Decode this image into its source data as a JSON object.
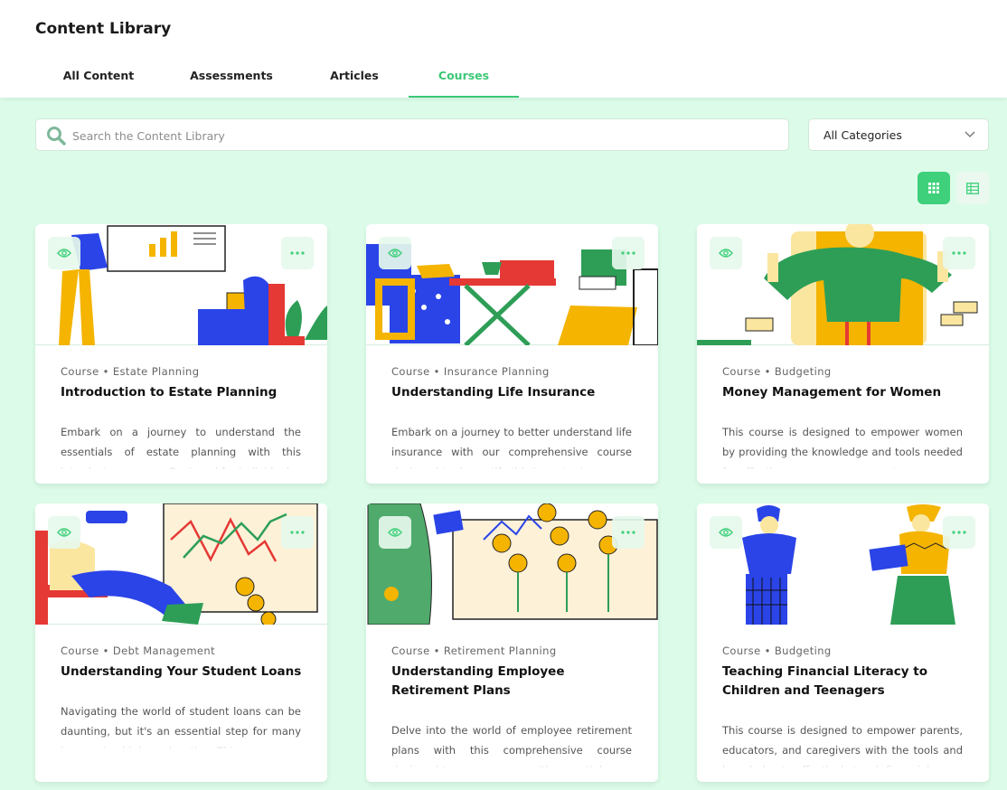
{
  "header": {
    "title": "Content Library",
    "tabs": [
      {
        "label": "All Content"
      },
      {
        "label": "Assessments"
      },
      {
        "label": "Articles"
      },
      {
        "label": "Courses",
        "active": true
      }
    ]
  },
  "search": {
    "placeholder": "Search the Content Library",
    "value": ""
  },
  "filter": {
    "selected": "All Categories"
  },
  "view": {
    "active": "grid"
  },
  "colors": {
    "accent": "#3ed07a",
    "background": "#dcfce9"
  },
  "cards": [
    {
      "meta": "Course • Estate Planning",
      "title": "Introduction to Estate Planning",
      "description": "Embark on a journey to understand the essentials of estate planning with this introductory course. Designed for individuals"
    },
    {
      "meta": "Course • Insurance Planning",
      "title": "Understanding Life Insurance",
      "description": "Embark on a journey to better understand life insurance with our comprehensive course designed to demystify this important"
    },
    {
      "meta": "Course • Budgeting",
      "title": "Money Management for Women",
      "description": "This course is designed to empower women by providing the knowledge and tools needed for effective money management"
    },
    {
      "meta": "Course • Debt Management",
      "title": "Understanding Your Student Loans",
      "description": "Navigating the world of student loans can be daunting, but it's an essential step for many in pursuing higher education. This course"
    },
    {
      "meta": "Course • Retirement Planning",
      "title": "Understanding Employee Retirement Plans",
      "description": "Delve into the world of employee retirement plans with this comprehensive course designed to empower you with essential"
    },
    {
      "meta": "Course • Budgeting",
      "title": "Teaching Financial Literacy to Children and Teenagers",
      "description": "This course is designed to empower parents, educators, and caregivers with the tools and knowledge to effectively teach financial"
    }
  ]
}
